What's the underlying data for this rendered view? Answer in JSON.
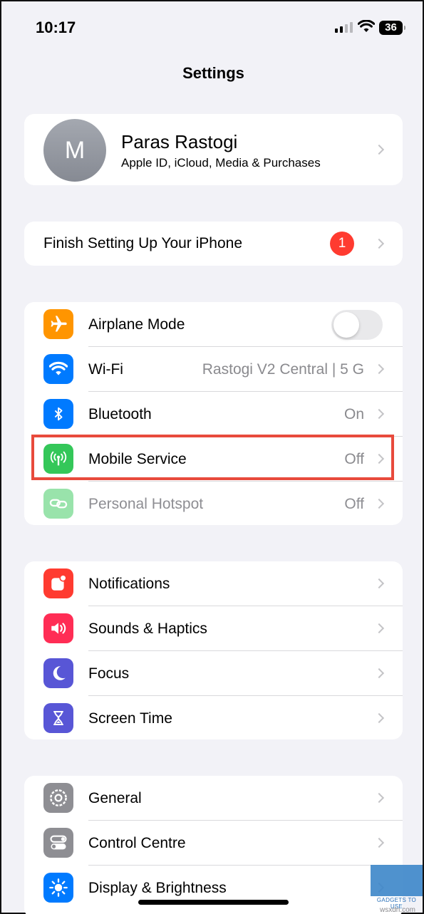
{
  "status_bar": {
    "time": "10:17",
    "battery": "36"
  },
  "header": {
    "title": "Settings"
  },
  "profile": {
    "initial": "M",
    "name": "Paras Rastogi",
    "subtitle": "Apple ID, iCloud, Media & Purchases"
  },
  "finish_setup": {
    "label": "Finish Setting Up Your iPhone",
    "badge": "1"
  },
  "connectivity": [
    {
      "label": "Airplane Mode",
      "icon": "airplane-icon",
      "color": "#ff9500",
      "toggle": false
    },
    {
      "label": "Wi-Fi",
      "icon": "wifi-icon",
      "color": "#007aff",
      "value": "Rastogi V2 Central |  5 G"
    },
    {
      "label": "Bluetooth",
      "icon": "bluetooth-icon",
      "color": "#007aff",
      "value": "On"
    },
    {
      "label": "Mobile Service",
      "icon": "antenna-icon",
      "color": "#34c759",
      "value": "Off"
    },
    {
      "label": "Personal Hotspot",
      "icon": "link-icon",
      "color": "#34c759",
      "value": "Off"
    }
  ],
  "notifications_group": [
    {
      "label": "Notifications",
      "icon": "bell-icon",
      "color": "#ff3b30"
    },
    {
      "label": "Sounds & Haptics",
      "icon": "speaker-icon",
      "color": "#ff2d55"
    },
    {
      "label": "Focus",
      "icon": "moon-icon",
      "color": "#5856d6"
    },
    {
      "label": "Screen Time",
      "icon": "hourglass-icon",
      "color": "#5856d6"
    }
  ],
  "general_group": [
    {
      "label": "General",
      "icon": "gear-icon",
      "color": "#8e8e93"
    },
    {
      "label": "Control Centre",
      "icon": "switches-icon",
      "color": "#8e8e93"
    },
    {
      "label": "Display & Brightness",
      "icon": "sun-icon",
      "color": "#007aff"
    }
  ],
  "watermark": {
    "text": "GADGETS TO USE",
    "site": "wsxdn.com"
  }
}
